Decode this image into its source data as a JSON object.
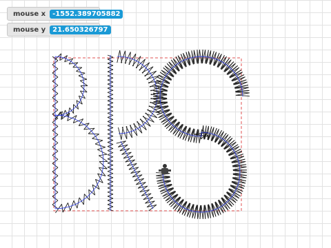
{
  "monitors": {
    "mouse_x": {
      "label": "mouse x",
      "value": "-1552.389705882"
    },
    "mouse_y": {
      "label": "mouse y",
      "value": "21.650326797"
    }
  },
  "colors": {
    "stitch": "#1a1a1a",
    "path": "#2a3be6",
    "hoop": "#e05050",
    "accent": "#1a9ad6"
  },
  "icons": {
    "cursor": "sprite-cursor-icon"
  }
}
